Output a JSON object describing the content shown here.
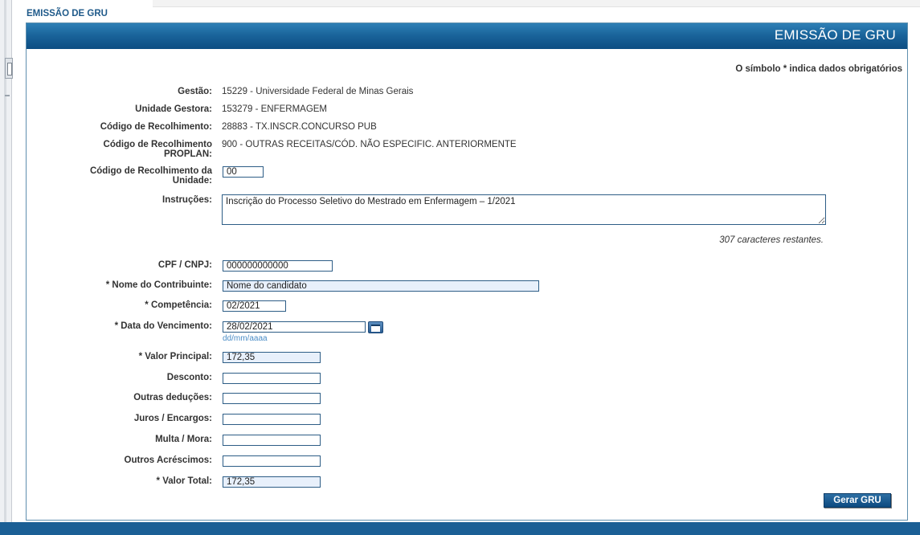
{
  "page_label": "EMISSÃO DE GRU",
  "panel_title": "EMISSÃO DE GRU",
  "required_note": "O símbolo * indica dados obrigatórios",
  "info": {
    "gestao_label": "Gestão:",
    "gestao_value": "15229 - Universidade Federal de Minas Gerais",
    "ug_label": "Unidade Gestora:",
    "ug_value": "153279 - ENFERMAGEM",
    "codigo_label": "Código de Recolhimento:",
    "codigo_value": "28883 - TX.INSCR.CONCURSO PUB",
    "proplan_label_line1": "Código de Recolhimento",
    "proplan_label_line2": "PROPLAN:",
    "proplan_value": "900 - OUTRAS RECEITAS/CÓD. NÃO ESPECIFIC. ANTERIORMENTE"
  },
  "form": {
    "unidade_label_line1": "Código de Recolhimento da",
    "unidade_label_line2": "Unidade:",
    "unidade_value": "00",
    "instrucoes_label": "Instruções:",
    "instrucoes_value": "Inscrição do Processo Seletivo do Mestrado em Enfermagem – 1/2021",
    "remaining_text": "307 caracteres restantes.",
    "cpf_label": "CPF / CNPJ:",
    "cpf_value": "000000000000",
    "nome_label": "* Nome do Contribuinte:",
    "nome_value": "Nome do candidato",
    "competencia_label": "* Competência:",
    "competencia_value": "02/2021",
    "vencimento_label": "* Data do Vencimento:",
    "vencimento_value": "28/02/2021",
    "vencimento_hint": "dd/mm/aaaa",
    "principal_label": "* Valor Principal:",
    "principal_value": "172,35",
    "desconto_label": "Desconto:",
    "desconto_value": "",
    "deducoes_label": "Outras deduções:",
    "deducoes_value": "",
    "juros_label": "Juros / Encargos:",
    "juros_value": "",
    "multa_label": "Multa / Mora:",
    "multa_value": "",
    "acrescimos_label": "Outros Acréscimos:",
    "acrescimos_value": "",
    "total_label": "* Valor Total:",
    "total_value": "172,35"
  },
  "submit_label": "Gerar GRU",
  "colors": {
    "header": "#1a649b",
    "link": "#4a8cc6",
    "filled_input": "#e8f0fb"
  },
  "icons": {
    "calendar": "calendar-icon"
  }
}
